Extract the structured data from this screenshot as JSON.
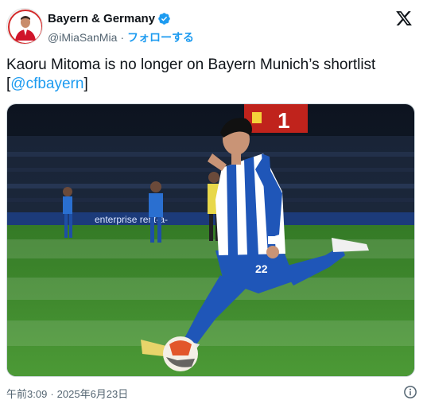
{
  "author": {
    "display_name": "Bayern & Germany",
    "handle": "@iMiaSanMia",
    "separator": "·",
    "follow_label": "フォローする",
    "verified": true,
    "avatar_icon": "avatar-player-photo",
    "verified_icon": "verified-badge-icon"
  },
  "tweet": {
    "text_main": "Kaoru Mitoma is no longer on Bayern Munich’s shortlist",
    "bracket_open": "[",
    "mention": "@cfbayern",
    "bracket_close": "]"
  },
  "media": {
    "scoreboard_score": "1",
    "ad_board_text": "enterprise   rent-a-",
    "player_number": "22",
    "description_icon": "football-photo"
  },
  "footer": {
    "time": "午前3:09",
    "separator": "·",
    "date": "2025年6月23日"
  },
  "colors": {
    "link": "#1d9bf0",
    "secondary_text": "#536471",
    "primary_text": "#0f1419",
    "pitch": "#3f8a2e",
    "kit_blue": "#1f56b8"
  },
  "icons": {
    "brand": "x-logo-icon",
    "info": "info-icon"
  }
}
